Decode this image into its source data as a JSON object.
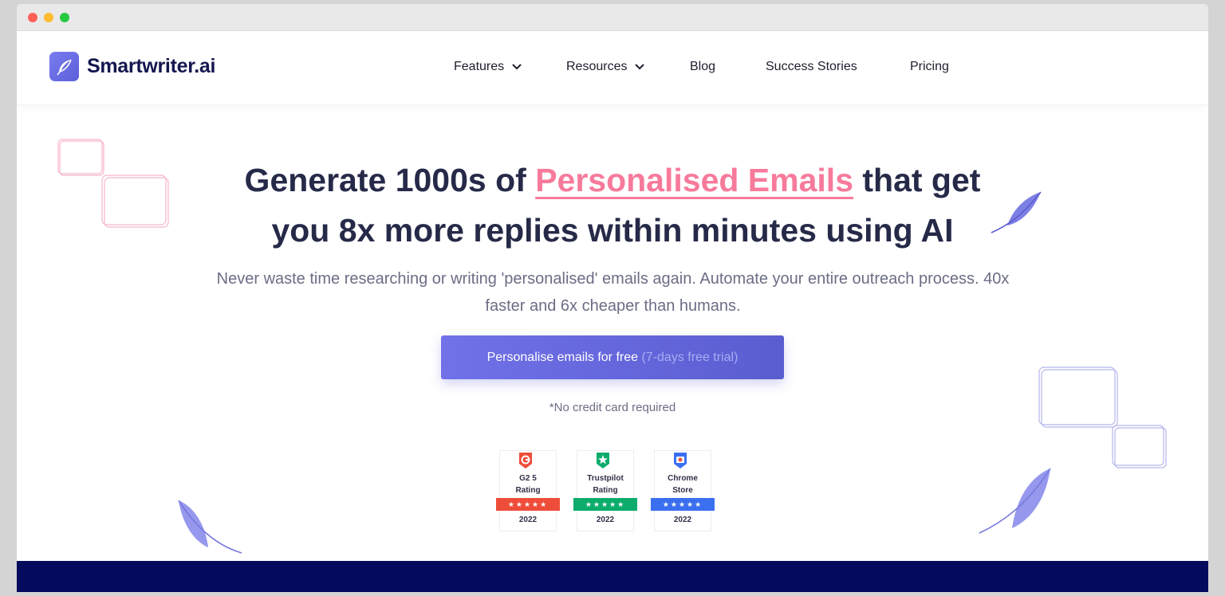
{
  "brand": {
    "name": "Smartwriter.ai",
    "logo_color": "#6b6ee6",
    "text_color": "#14164f"
  },
  "nav": {
    "items": [
      {
        "label": "Features",
        "dropdown": true
      },
      {
        "label": "Resources",
        "dropdown": true
      },
      {
        "label": "Blog",
        "dropdown": false
      },
      {
        "label": "Success Stories",
        "dropdown": false
      },
      {
        "label": "Pricing",
        "dropdown": false
      }
    ]
  },
  "hero": {
    "title_before": "Generate 1000s of ",
    "title_highlight": "Personalised Emails",
    "title_after": " that get",
    "title_line2": "you 8x more replies within minutes using AI",
    "subtitle": "Never waste time researching or writing 'personalised' emails again. Automate your entire outreach process. 40x faster and 6x cheaper than humans.",
    "cta_main": "Personalise emails for free ",
    "cta_note": "(7-days free trial)",
    "no_cc": "*No credit card required",
    "highlight_color": "#f77a9b",
    "accent_color": "#6366e0"
  },
  "badges": [
    {
      "icon": "g2-icon",
      "label_line1": "G2 5",
      "label_line2": "Rating",
      "stars": "★★★★★",
      "year": "2022",
      "color": "#ee4d3a"
    },
    {
      "icon": "trustpilot-star-icon",
      "label_line1": "Trustpilot",
      "label_line2": "Rating",
      "stars": "★★★★★",
      "year": "2022",
      "color": "#0dac6c"
    },
    {
      "icon": "chrome-store-icon",
      "label_line1": "Chrome",
      "label_line2": "Store",
      "stars": "★★★★★",
      "year": "2022",
      "color": "#3a6ff0"
    }
  ]
}
